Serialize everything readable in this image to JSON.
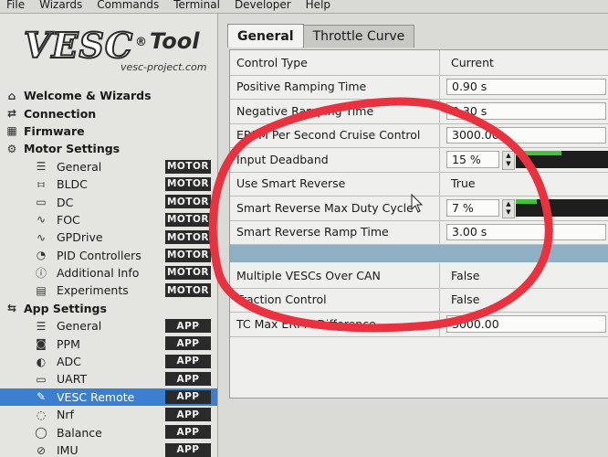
{
  "menu": [
    "File",
    "Wizards",
    "Commands",
    "Terminal",
    "Developer",
    "Help"
  ],
  "logo": {
    "brand": "VESC",
    "tool": "Tool",
    "reg": "®",
    "url": "vesc-project.com"
  },
  "sidebar": {
    "items": [
      {
        "label": "Welcome & Wizards",
        "level": "top",
        "icon": "home-icon",
        "glyph": "⌂"
      },
      {
        "label": "Connection",
        "level": "top",
        "icon": "connection-icon",
        "glyph": "⇄"
      },
      {
        "label": "Firmware",
        "level": "top",
        "icon": "firmware-icon",
        "glyph": "▦"
      },
      {
        "label": "Motor Settings",
        "level": "top",
        "icon": "motor-icon",
        "glyph": "⚙"
      },
      {
        "label": "General",
        "level": "sub",
        "icon": "sliders-icon",
        "glyph": "☰",
        "badge": "MOTOR"
      },
      {
        "label": "BLDC",
        "level": "sub",
        "icon": "bldc-icon",
        "glyph": "⧦",
        "badge": "MOTOR"
      },
      {
        "label": "DC",
        "level": "sub",
        "icon": "battery-icon",
        "glyph": "▭",
        "badge": "MOTOR"
      },
      {
        "label": "FOC",
        "level": "sub",
        "icon": "foc-icon",
        "glyph": "∿",
        "badge": "MOTOR"
      },
      {
        "label": "GPDrive",
        "level": "sub",
        "icon": "gpdrive-icon",
        "glyph": "∿",
        "badge": "MOTOR"
      },
      {
        "label": "PID Controllers",
        "level": "sub",
        "icon": "gauge-icon",
        "glyph": "◔",
        "badge": "MOTOR"
      },
      {
        "label": "Additional Info",
        "level": "sub",
        "icon": "info-icon",
        "glyph": "ⓘ",
        "badge": "MOTOR"
      },
      {
        "label": "Experiments",
        "level": "sub",
        "icon": "calculator-icon",
        "glyph": "▤",
        "badge": "MOTOR"
      },
      {
        "label": "App Settings",
        "level": "top",
        "icon": "app-settings-icon",
        "glyph": "⇆"
      },
      {
        "label": "General",
        "level": "sub",
        "icon": "sliders-icon",
        "glyph": "☰",
        "badge": "APP"
      },
      {
        "label": "PPM",
        "level": "sub",
        "icon": "gamepad-icon",
        "glyph": "◙",
        "badge": "APP"
      },
      {
        "label": "ADC",
        "level": "sub",
        "icon": "adc-icon",
        "glyph": "◐",
        "badge": "APP"
      },
      {
        "label": "UART",
        "level": "sub",
        "icon": "uart-icon",
        "glyph": "▭",
        "badge": "APP"
      },
      {
        "label": "VESC Remote",
        "level": "sub",
        "icon": "remote-icon",
        "glyph": "✎",
        "badge": "APP",
        "selected": true
      },
      {
        "label": "Nrf",
        "level": "sub",
        "icon": "wireless-icon",
        "glyph": "◌",
        "badge": "APP"
      },
      {
        "label": "Balance",
        "level": "sub",
        "icon": "balance-icon",
        "glyph": "◯",
        "badge": "APP"
      },
      {
        "label": "IMU",
        "level": "sub",
        "icon": "imu-icon",
        "glyph": "⊘",
        "badge": "APP"
      }
    ]
  },
  "tabs": [
    {
      "label": "General",
      "active": true
    },
    {
      "label": "Throttle Curve",
      "active": false
    }
  ],
  "params": [
    {
      "label": "Control Type",
      "value": "Current",
      "kind": "plain"
    },
    {
      "label": "Positive Ramping Time",
      "value": "0.90 s",
      "kind": "box"
    },
    {
      "label": "Negative Ramping Time",
      "value": "0.30 s",
      "kind": "box"
    },
    {
      "label": "ERPM Per Second Cruise Control",
      "value": "3000.00",
      "kind": "box"
    },
    {
      "label": "Input Deadband",
      "value": "15 %",
      "kind": "percent",
      "level": 0.15
    },
    {
      "label": "Use Smart Reverse",
      "value": "True",
      "kind": "plain"
    },
    {
      "label": "Smart Reverse Max Duty Cycle",
      "value": "7 %",
      "kind": "percent",
      "level": 0.07
    },
    {
      "label": "Smart Reverse Ramp Time",
      "value": "3.00 s",
      "kind": "box"
    },
    {
      "label": "Multiple VESCs Over CAN",
      "value": "False",
      "kind": "plain"
    },
    {
      "label": "Traction Control",
      "value": "False",
      "kind": "plain"
    },
    {
      "label": "TC Max ERPM Difference",
      "value": "3000.00",
      "kind": "box"
    }
  ],
  "colors": {
    "annotation": "#e8323f",
    "selection": "#3a7fd0",
    "bar_fill": "#45c23b",
    "separator": "#8fb0c4"
  }
}
